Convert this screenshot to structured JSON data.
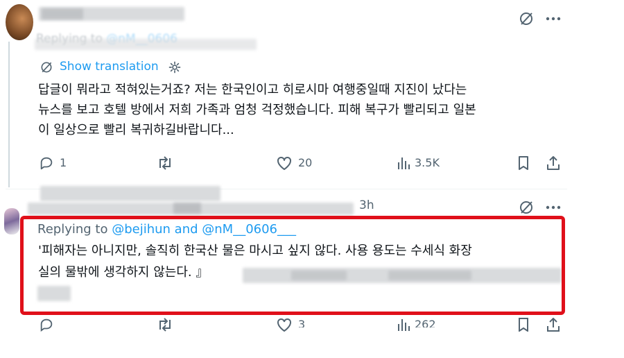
{
  "tweet1": {
    "replying_to_prefix": "Replying to",
    "replying_handle": "@nM__0606",
    "show_translation": "Show translation",
    "body_lines": [
      "답글이 뭐라고 적혀있는거죠? 저는 한국인이고 히로시마 여행중일때 지진이 났다는",
      "뉴스를 보고 호텔 방에서 저희 가족과 엄청 걱정했습니다. 피해 복구가 빨리되고 일본",
      "이 일상으로 빨리 복귀하길바랍니다..."
    ],
    "actions": {
      "reply_count": "1",
      "like_count": "20",
      "views_count": "3.5K"
    }
  },
  "tweet2": {
    "timestamp": "3h",
    "replying_to_prefix": "Replying to",
    "replying_handles": "@bejihun and @nM__0606___",
    "body_lines": [
      "'피해자는 아니지만, 솔직히 한국산 물은 마시고 싶지 않다. 사용 용도는 수세식 화장",
      "실의 물밖에 생각하지 않는다. 』"
    ],
    "actions": {
      "like_count": "3",
      "views_count": "262"
    }
  },
  "colors": {
    "highlight_border": "#e0101a",
    "link": "#1d9bf0",
    "muted": "#536471",
    "text": "#0f1419"
  }
}
